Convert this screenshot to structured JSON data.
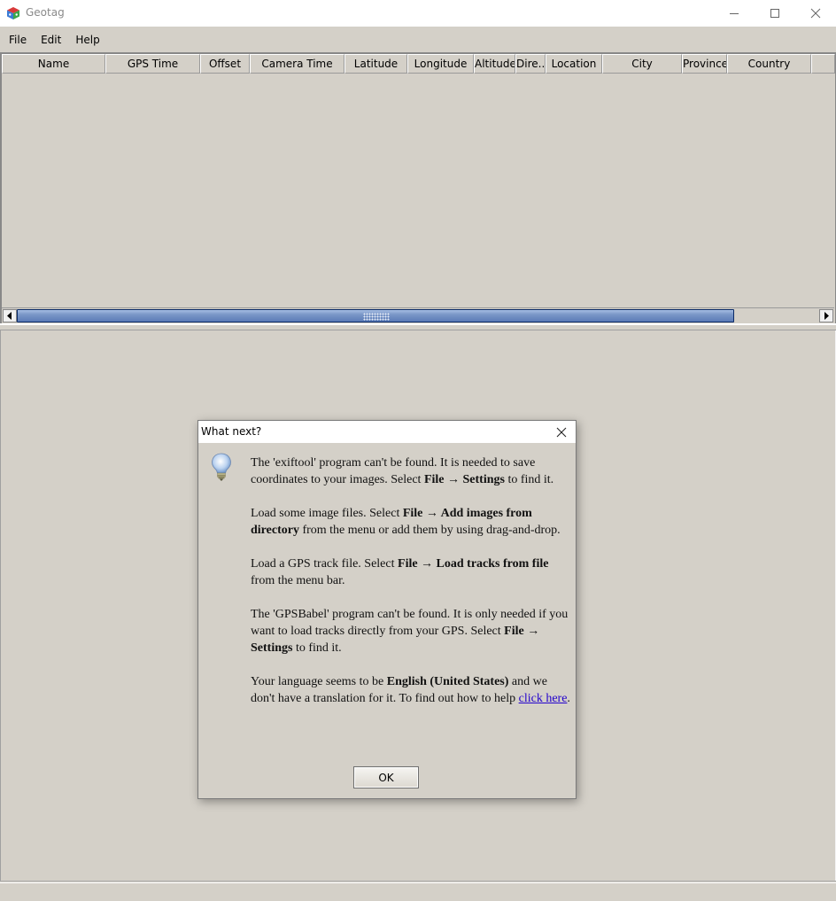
{
  "window": {
    "title": "Geotag",
    "icon": "geotag-cube-icon",
    "controls": {
      "minimize_icon": "minimize-icon",
      "maximize_icon": "maximize-icon",
      "close_icon": "close-icon"
    }
  },
  "menubar": {
    "items": [
      {
        "label": "File"
      },
      {
        "label": "Edit"
      },
      {
        "label": "Help"
      }
    ]
  },
  "table": {
    "columns": [
      {
        "label": "Name"
      },
      {
        "label": "GPS Time"
      },
      {
        "label": "Offset"
      },
      {
        "label": "Camera Time"
      },
      {
        "label": "Latitude"
      },
      {
        "label": "Longitude"
      },
      {
        "label": "Altitude"
      },
      {
        "label": "Dire..."
      },
      {
        "label": "Location"
      },
      {
        "label": "City"
      },
      {
        "label": "Province"
      },
      {
        "label": "Country"
      },
      {
        "label": ""
      }
    ],
    "rows": [],
    "horizontal_scroll": {
      "thumb_start_fraction": 0.0,
      "thumb_visible_fraction": 0.894
    }
  },
  "dialog": {
    "title": "What next?",
    "icon": "lightbulb-icon",
    "close_icon": "close-icon",
    "paragraphs": {
      "p1": {
        "t1": "The 'exiftool' program can't be found. It is needed to save coordinates to your images. Select ",
        "b1": "File → Settings",
        "t2": " to find it."
      },
      "p2": {
        "t1": "Load some image files. Select ",
        "b1": "File → Add images from directory",
        "t2": " from the menu or add them by using drag-and-drop."
      },
      "p3": {
        "t1": "Load a GPS track file. Select ",
        "b1": "File → Load tracks from file",
        "t2": " from the menu bar."
      },
      "p4": {
        "t1": "The 'GPSBabel' program can't be found. It is only needed if you want to load tracks directly from your GPS. Select ",
        "b1": "File → Settings",
        "t2": " to find it."
      },
      "p5": {
        "t1": "Your language seems to be ",
        "b1": "English (United States)",
        "t2": " and we don't have a translation for it. To find out how to help ",
        "link": "click here",
        "t3": "."
      }
    },
    "ok_label": "OK",
    "link_color": "#2200cc"
  }
}
